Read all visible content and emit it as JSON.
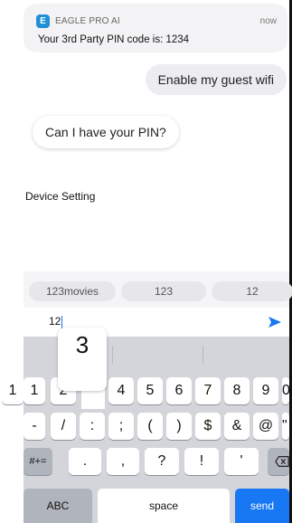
{
  "notification": {
    "app_name": "EAGLE PRO AI",
    "time": "now",
    "message": "Your 3rd Party PIN code is: 1234",
    "icon": "eagle-app-icon"
  },
  "chat": {
    "outgoing": "Enable my guest wifi",
    "incoming": "Can I have your PIN?",
    "system_label": "Device Setting"
  },
  "suggestions": [
    "123movies",
    "123",
    "12"
  ],
  "input": {
    "value": "12"
  },
  "keyboard": {
    "predictions": [
      "\"1",
      ""
    ],
    "popup_key": "3",
    "row1": [
      "1",
      "2",
      "3",
      "4",
      "5",
      "6",
      "7",
      "8",
      "9",
      "0"
    ],
    "row2": [
      "-",
      "/",
      ":",
      ";",
      "(",
      ")",
      "$",
      "&",
      "@",
      "\""
    ],
    "row3": [
      ".",
      ",",
      "?",
      "!",
      "'"
    ],
    "symbols_key": "#+=",
    "abc_key": "ABC",
    "space_key": "space",
    "send_key": "send",
    "accent_color": "#1877f2"
  }
}
